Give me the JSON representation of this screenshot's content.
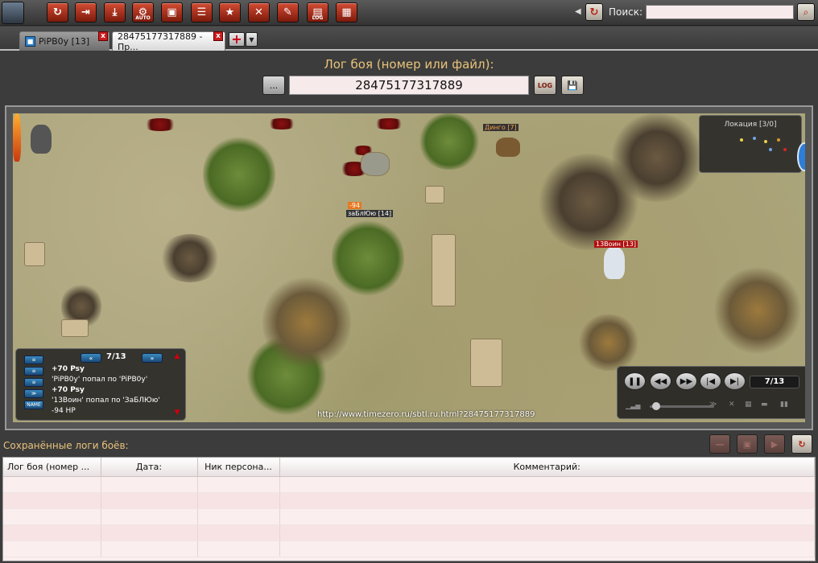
{
  "toolbar": {
    "buttons": [
      {
        "name": "refresh",
        "glyph": "↻"
      },
      {
        "name": "login",
        "glyph": "⇥"
      },
      {
        "name": "download",
        "glyph": "⤓"
      },
      {
        "name": "auto",
        "glyph": "⚙",
        "label": "AUTO"
      },
      {
        "name": "backpack",
        "glyph": "▣"
      },
      {
        "name": "list",
        "glyph": "☰"
      },
      {
        "name": "star",
        "glyph": "★"
      },
      {
        "name": "tools",
        "glyph": "✕"
      },
      {
        "name": "notes",
        "glyph": "✎"
      },
      {
        "name": "log",
        "glyph": "▤",
        "label": "LOG"
      },
      {
        "name": "package",
        "glyph": "▦"
      }
    ],
    "search_label": "Поиск:",
    "search_value": "",
    "colors": {
      "accent": "#b62310"
    }
  },
  "tabs": {
    "items": [
      {
        "label": "PiPB0y [13]",
        "active": false
      },
      {
        "label": "28475177317889 - Пр...",
        "active": true
      }
    ],
    "close_glyph": "x",
    "add_glyph": "+",
    "menu_glyph": "▼"
  },
  "log_header": {
    "title": "Лог боя (номер или файл):",
    "browse_label": "...",
    "value": "28475177317889",
    "open_label": "LOG",
    "save_glyph": "💾"
  },
  "game": {
    "minimap_title": "Локация [3/0]",
    "characters": [
      {
        "name": "Динго [7]"
      },
      {
        "name": "заБлЮю [14]",
        "damage": "-94"
      },
      {
        "name": "13Воин [13]"
      }
    ],
    "combat_log": {
      "counter": "7/13",
      "prev": "«",
      "next": "»",
      "side_buttons": [
        "≡",
        "≡",
        "≡",
        "≫",
        "NAME"
      ],
      "lines": [
        {
          "text": "+70 Psy",
          "bold": true
        },
        {
          "text": "'PiPB0y' попал по 'PiPB0y'",
          "bold": false
        },
        {
          "text": "+70 Psy",
          "bold": true
        },
        {
          "text": "'13Воин' попал по 'ЗаБЛЮю'",
          "bold": false
        },
        {
          "text": "-94 HP",
          "bold": false
        }
      ]
    },
    "player": {
      "pause": "❚❚",
      "rewind": "◀◀",
      "forward": "▶▶",
      "prev": "|◀",
      "next": "▶|",
      "counter": "7/13",
      "volume_fraction": 0.1
    },
    "url": "http://www.timezero.ru/sbtl.ru.html?28475177317889"
  },
  "saved_logs": {
    "title": "Сохранённые логи боёв:",
    "columns": [
      "Лог боя (номер ...",
      "Дата:",
      "Ник персона...",
      "Комментарий:"
    ],
    "rows": []
  }
}
